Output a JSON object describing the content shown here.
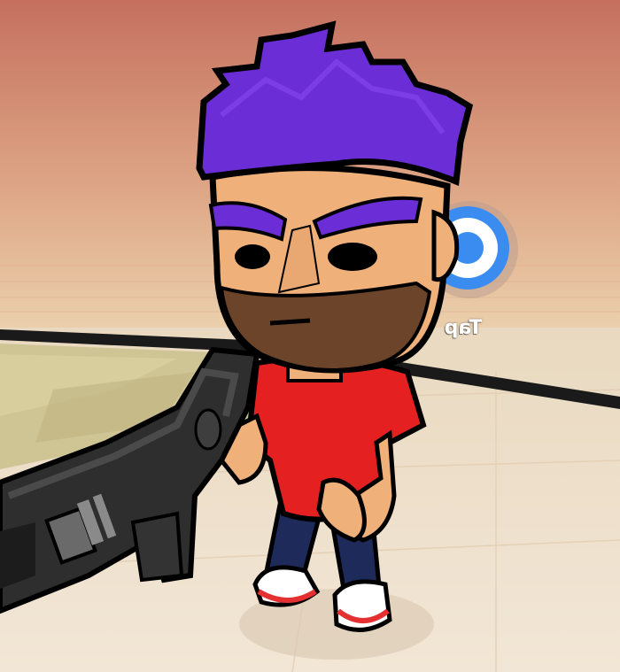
{
  "scene": {
    "sky_top_color": "#c97565",
    "sky_bottom_color": "#e9c9a2",
    "floor_color": "#efe1cd",
    "platform_color": "#cfc596"
  },
  "tap_button": {
    "label": "Tap",
    "icon": "tap-circle-icon",
    "color": "#3b8cf0"
  },
  "character": {
    "hair_color": "#6a2dd6",
    "skin_color": "#f0b07a",
    "beard_color": "#6b4429",
    "shirt_color": "#e42020",
    "pants_color": "#1e2a5a",
    "shoe_color": "#ffffff",
    "shoe_accent": "#e43030"
  },
  "weapon": {
    "icon": "rifle-icon",
    "color": "#2a2a2a"
  }
}
